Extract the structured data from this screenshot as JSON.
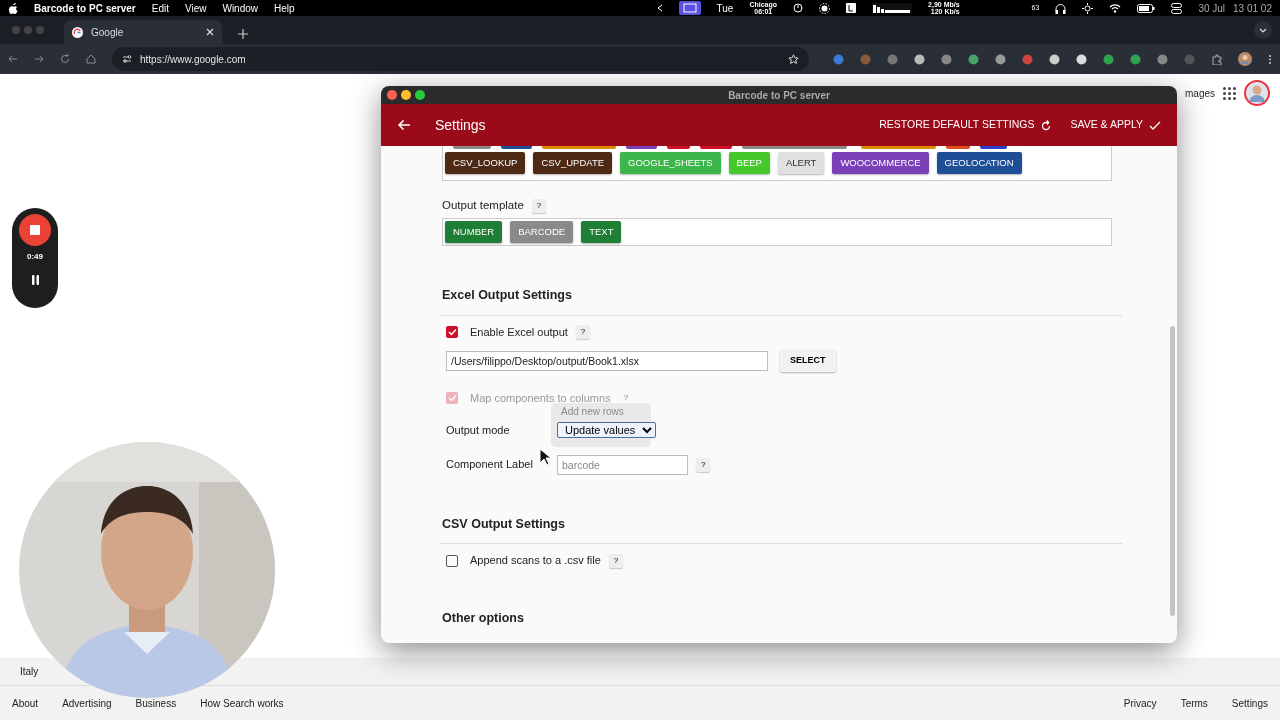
{
  "menubar": {
    "app": "Barcode to PC server",
    "menus": [
      "Edit",
      "View",
      "Window",
      "Help"
    ],
    "status": {
      "day": "Tue",
      "city": "Chicago",
      "city_time": "06:01",
      "net_down": "2,90 Mb/s",
      "net_up": "120 Kb/s",
      "number": "63",
      "date": "30 Jul",
      "time": "13 01 02"
    }
  },
  "browser": {
    "tab": {
      "title": "Google"
    },
    "url": "https://www.google.com"
  },
  "google": {
    "header_link": "mages",
    "country": "Italy",
    "footer_left": [
      "About",
      "Advertising",
      "Business",
      "How Search works"
    ],
    "footer_right": [
      "Privacy",
      "Terms",
      "Settings"
    ]
  },
  "recorder": {
    "elapsed": "0:49"
  },
  "app": {
    "window_title": "Barcode to PC server",
    "title": "Settings",
    "actions": [
      "RESTORE DEFAULT SETTINGS",
      "SAVE & APPLY"
    ],
    "hidden_tags": [
      {
        "color": "#8a8a8a"
      },
      {
        "color": "#1d4e96"
      },
      {
        "color": "#e08a00"
      },
      {
        "color": "#7b3fb8"
      },
      {
        "color": "#d0102a"
      },
      {
        "color": "#d0102a"
      },
      {
        "color": "#8a8a8a"
      },
      {
        "color": "#e08a00"
      },
      {
        "color": "#e0501a"
      },
      {
        "color": "#2a3fd0"
      }
    ],
    "tags": [
      {
        "label": "CSV_LOOKUP",
        "color": "#4e2a14"
      },
      {
        "label": "CSV_UPDATE",
        "color": "#4e2a14"
      },
      {
        "label": "GOOGLE_SHEETS",
        "color": "#3cb54a"
      },
      {
        "label": "BEEP",
        "color": "#44c82a"
      },
      {
        "label": "ALERT",
        "color": "#e0e0e0"
      },
      {
        "label": "WOOCOMMERCE",
        "color": "#7b3fb8"
      },
      {
        "label": "GEOLOCATION",
        "color": "#1d4e96"
      }
    ],
    "output_template": {
      "label": "Output template",
      "help": "?",
      "tags": [
        {
          "label": "NUMBER",
          "color": "#1e7e34"
        },
        {
          "label": "BARCODE",
          "color": "#8a8a8a"
        },
        {
          "label": "TEXT",
          "color": "#1e7e34"
        }
      ]
    },
    "excel": {
      "heading": "Excel Output Settings",
      "enable": {
        "label": "Enable Excel output",
        "checked": true,
        "disabled": false,
        "help": "?"
      },
      "path": "/Users/filippo/Desktop/output/Book1.xlsx",
      "select_button": "SELECT",
      "map": {
        "label": "Map components to columns",
        "checked": true,
        "disabled": true,
        "help": "?"
      },
      "output_mode": {
        "label": "Output mode",
        "value": "Update values",
        "fading_option": "Add new rows"
      },
      "component_label": {
        "label": "Component Label",
        "placeholder": "barcode",
        "help": "?"
      }
    },
    "csv": {
      "heading": "CSV Output Settings",
      "append": {
        "label": "Append scans to a .csv file",
        "checked": false,
        "disabled": false,
        "help": "?"
      }
    },
    "other_heading": "Other options"
  }
}
